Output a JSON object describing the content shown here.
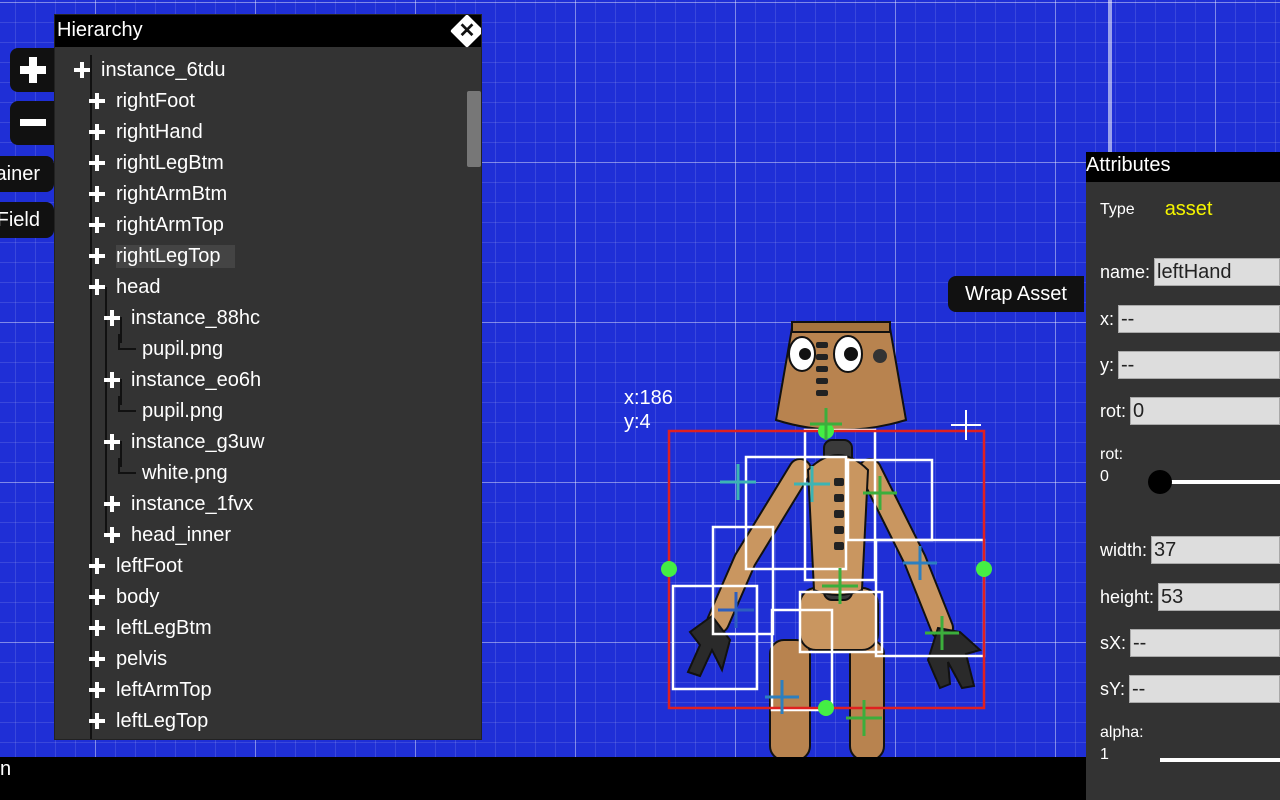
{
  "canvas": {
    "coord_x": "x:186",
    "coord_y": "y:4",
    "wrap_asset_label": "Wrap Asset"
  },
  "zoom": {
    "in_symbol": "+",
    "out_symbol": "−"
  },
  "side_tabs": [
    "ainer",
    "Field"
  ],
  "hierarchy": {
    "title": "Hierarchy",
    "close_symbol": "✕",
    "items": [
      {
        "label": "instance_6tdu",
        "level": 0,
        "type": "node"
      },
      {
        "label": "rightFoot",
        "level": 1,
        "type": "node"
      },
      {
        "label": "rightHand",
        "level": 1,
        "type": "node"
      },
      {
        "label": "rightLegBtm",
        "level": 1,
        "type": "node"
      },
      {
        "label": "rightArmBtm",
        "level": 1,
        "type": "node"
      },
      {
        "label": "rightArmTop",
        "level": 1,
        "type": "node"
      },
      {
        "label": "rightLegTop",
        "level": 1,
        "type": "node",
        "selected": true
      },
      {
        "label": "head",
        "level": 1,
        "type": "node"
      },
      {
        "label": "instance_88hc",
        "level": 2,
        "type": "node"
      },
      {
        "label": "pupil.png",
        "level": 3,
        "type": "leaf"
      },
      {
        "label": "instance_eo6h",
        "level": 2,
        "type": "node"
      },
      {
        "label": "pupil.png",
        "level": 3,
        "type": "leaf"
      },
      {
        "label": "instance_g3uw",
        "level": 2,
        "type": "node"
      },
      {
        "label": "white.png",
        "level": 3,
        "type": "leaf"
      },
      {
        "label": "instance_1fvx",
        "level": 2,
        "type": "node"
      },
      {
        "label": "head_inner",
        "level": 2,
        "type": "node"
      },
      {
        "label": "leftFoot",
        "level": 1,
        "type": "node"
      },
      {
        "label": "body",
        "level": 1,
        "type": "node"
      },
      {
        "label": "leftLegBtm",
        "level": 1,
        "type": "node"
      },
      {
        "label": "pelvis",
        "level": 1,
        "type": "node"
      },
      {
        "label": "leftArmTop",
        "level": 1,
        "type": "node"
      },
      {
        "label": "leftLegTop",
        "level": 1,
        "type": "node"
      }
    ]
  },
  "statusbar": {
    "text": "n"
  },
  "attributes": {
    "title": "Attributes",
    "type_label": "Type",
    "type_value": "asset",
    "name_label": "name:",
    "name_value": "leftHand",
    "x_label": "x:",
    "x_value": "--",
    "y_label": "y:",
    "y_value": "--",
    "rot_label": "rot:",
    "rot_value": "0",
    "rot_slider_label": "rot:",
    "rot_slider_value": "0",
    "width_label": "width:",
    "width_value": "37",
    "height_label": "height:",
    "height_value": "53",
    "sx_label": "sX:",
    "sx_value": "--",
    "sy_label": "sY:",
    "sy_value": "--",
    "alpha_label": "alpha:",
    "alpha_value": "1"
  },
  "colors": {
    "background": "#1f2fd6",
    "panel": "#333333",
    "selection_box": "#e02020",
    "handle": "#44ee44",
    "type_value": "#f5f500"
  }
}
